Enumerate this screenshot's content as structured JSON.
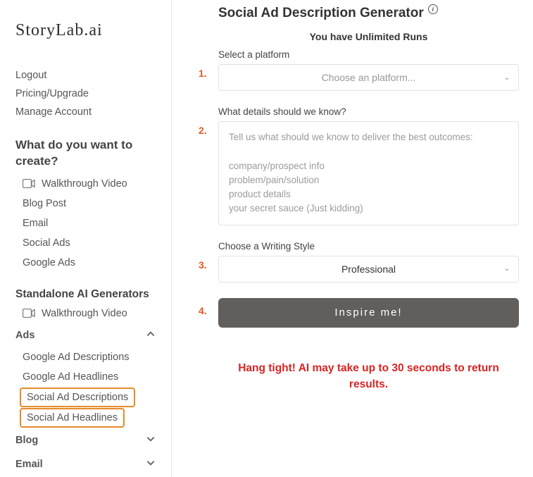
{
  "logo": "StoryLab.ai",
  "account_links": [
    "Logout",
    "Pricing/Upgrade",
    "Manage Account"
  ],
  "create_heading": "What do you want to create?",
  "create_items": [
    "Walkthrough Video",
    "Blog Post",
    "Email",
    "Social Ads",
    "Google Ads"
  ],
  "standalone_heading": "Standalone AI Generators",
  "standalone_items": [
    "Walkthrough Video"
  ],
  "ads_group": {
    "label": "Ads",
    "expanded": true,
    "items": [
      "Google Ad Descriptions",
      "Google Ad Headlines",
      "Social Ad Descriptions",
      "Social Ad Headlines"
    ]
  },
  "blog_group": {
    "label": "Blog"
  },
  "email_group": {
    "label": "Email"
  },
  "main": {
    "title": "Social Ad Description Generator",
    "subtitle": "You have Unlimited Runs",
    "step1_label": "Select a platform",
    "step1_placeholder": "Choose an platform...",
    "step2_label": "What details should we know?",
    "step2_placeholder": "Tell us what should we know to deliver the best outcomes:\n\ncompany/prospect info\nproblem/pain/solution\nproduct details\nyour secret sauce (Just kidding)",
    "step3_label": "Choose a Writing Style",
    "step3_value": "Professional",
    "step4_button": "Inspire me!",
    "wait_message": "Hang tight! AI may take up to 30 seconds to return results."
  },
  "numbers": {
    "s1": "1.",
    "s2": "2.",
    "s3": "3.",
    "s4": "4."
  }
}
